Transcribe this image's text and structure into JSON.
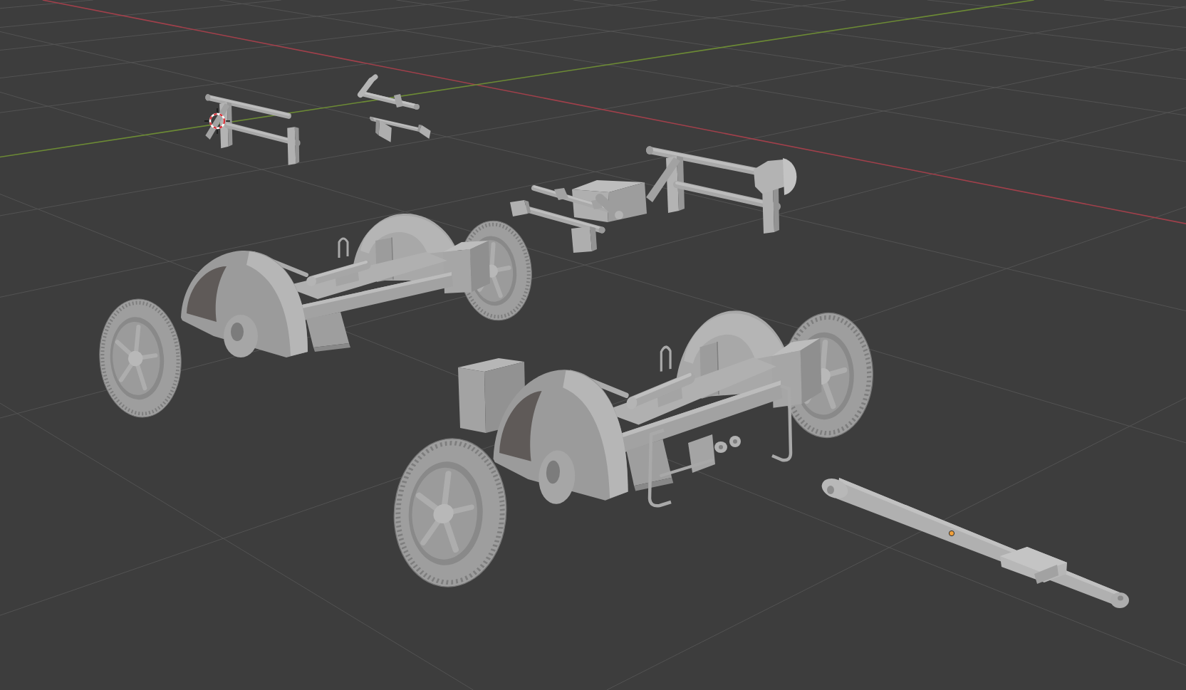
{
  "viewport": {
    "axes": [
      {
        "kind": "x",
        "color": "#a1404b"
      },
      {
        "kind": "y",
        "color": "#6c8a35"
      }
    ],
    "cursor_3d": true,
    "objects": [
      {
        "kind": "bracket",
        "plate": false,
        "selected": false
      },
      {
        "kind": "lever",
        "selected": false
      },
      {
        "kind": "rod",
        "selected": false
      },
      {
        "kind": "bracket",
        "plate": true,
        "selected": false
      },
      {
        "kind": "rod",
        "selected": false
      },
      {
        "kind": "housing",
        "selected": false
      },
      {
        "kind": "chassis",
        "selected": false
      },
      {
        "kind": "chassis",
        "selected": false
      },
      {
        "kind": "drawbar",
        "selected": true
      }
    ]
  }
}
